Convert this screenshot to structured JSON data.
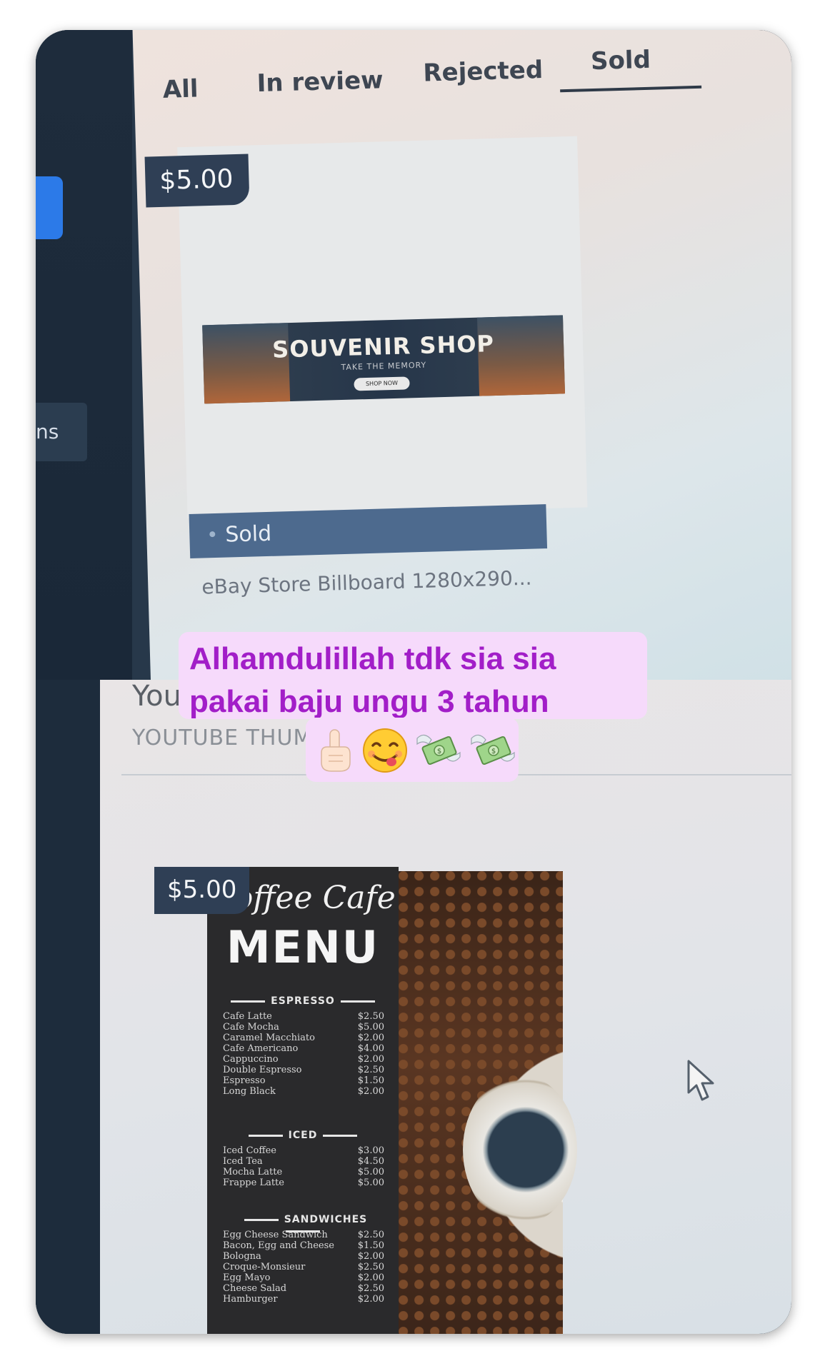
{
  "top_screenshot": {
    "sidebar": {
      "partial_label": "ns"
    },
    "tabs": [
      {
        "label": "All"
      },
      {
        "label": "In review"
      },
      {
        "label": "Rejected"
      },
      {
        "label": "Sold",
        "active": true
      }
    ],
    "item": {
      "price": "$5.00",
      "banner": {
        "title": "SOUVENIR SHOP",
        "tagline": "TAKE THE MEMORY",
        "button": "SHOP NOW"
      },
      "status": "Sold",
      "title": "eBay Store Billboard 1280x290..."
    }
  },
  "bottom_screenshot": {
    "heading_partial": "You",
    "subheading_partial": "YOUTUBE THUM",
    "item": {
      "price": "$5.00",
      "menu": {
        "script_title": "Coffee Cafe",
        "big_title": "MENU",
        "sections": [
          {
            "name": "ESPRESSO",
            "items": [
              {
                "name": "Cafe Latte",
                "price": "$2.50"
              },
              {
                "name": "Cafe Mocha",
                "price": "$5.00"
              },
              {
                "name": "Caramel Macchiato",
                "price": "$2.00"
              },
              {
                "name": "Cafe Americano",
                "price": "$4.00"
              },
              {
                "name": "Cappuccino",
                "price": "$2.00"
              },
              {
                "name": "Double Espresso",
                "price": "$2.50"
              },
              {
                "name": "Espresso",
                "price": "$1.50"
              },
              {
                "name": "Long Black",
                "price": "$2.00"
              }
            ]
          },
          {
            "name": "ICED",
            "items": [
              {
                "name": "Iced Coffee",
                "price": "$3.00"
              },
              {
                "name": "Iced Tea",
                "price": "$4.50"
              },
              {
                "name": "Mocha Latte",
                "price": "$5.00"
              },
              {
                "name": "Frappe Latte",
                "price": "$5.00"
              }
            ]
          },
          {
            "name": "SANDWICHES",
            "items": [
              {
                "name": "Egg Cheese Sandwich",
                "price": "$2.50"
              },
              {
                "name": "Bacon, Egg and Cheese",
                "price": "$1.50"
              },
              {
                "name": "Bologna",
                "price": "$2.00"
              },
              {
                "name": "Croque-Monsieur",
                "price": "$2.50"
              },
              {
                "name": "Egg Mayo",
                "price": "$2.00"
              },
              {
                "name": "Cheese Salad",
                "price": "$2.50"
              },
              {
                "name": "Hamburger",
                "price": "$2.00"
              }
            ]
          }
        ]
      }
    }
  },
  "caption": {
    "line1": "Alhamdulillah tdk sia sia",
    "line2": "pakai baju ungu 3 tahun",
    "emojis": [
      "☝🏻",
      "😋",
      "💸",
      "💸"
    ]
  },
  "colors": {
    "caption_text": "#a21ec8",
    "caption_bg": "#f6dafb",
    "price_badge": "#2f3f55",
    "status_bar": "#4d6a8e"
  }
}
